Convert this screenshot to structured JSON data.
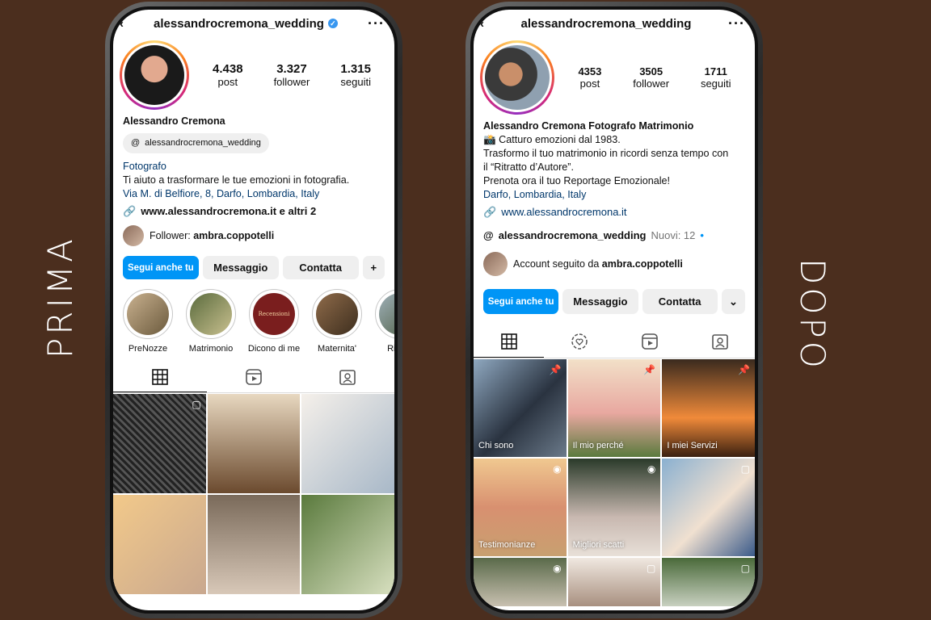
{
  "labels": {
    "before": "PRIMA",
    "after": "DOPO"
  },
  "before": {
    "username": "alessandrocremona_wedding",
    "more": "···",
    "stats": [
      {
        "num": "4.438",
        "label": "post"
      },
      {
        "num": "3.327",
        "label": "follower"
      },
      {
        "num": "1.315",
        "label": "seguiti"
      }
    ],
    "name": "Alessandro Cremona",
    "threads_handle": "alessandrocremona_wedding",
    "category": "Fotografo",
    "bio": "Ti aiuto a trasformare le tue emozioni in fotografia.",
    "address": "Via M. di Belfiore, 8, Darfo, Lombardia, Italy",
    "website": "www.alessandrocremona.it e altri 2",
    "follower_prefix": "Follower: ",
    "follower_name": "ambra.coppotelli",
    "buttons": {
      "follow": "Segui anche tu",
      "message": "Messaggio",
      "contact": "Contatta",
      "add": "+"
    },
    "highlights": [
      "PreNozze",
      "Matrimonio",
      "Dicono di me",
      "Maternita'",
      "Ritratti"
    ],
    "highlight_text": "Recensioni"
  },
  "after": {
    "username": "alessandrocremona_wedding",
    "more": "···",
    "stats": [
      {
        "num": "4353",
        "label": "post"
      },
      {
        "num": "3505",
        "label": "follower"
      },
      {
        "num": "1711",
        "label": "seguiti"
      }
    ],
    "name": "Alessandro Cremona Fotografo Matrimonio",
    "bio_lines": [
      "📸 Catturo emozioni dal 1983.",
      "Trasformo il tuo matrimonio in ricordi senza tempo con",
      "il “Ritratto d’Autore”.",
      "Prenota ora il tuo Reportage Emozionale!"
    ],
    "location": "Darfo, Lombardia, Italy",
    "website": "www.alessandrocremona.it",
    "threads_handle": "alessandrocremona_wedding",
    "threads_new": "Nuovi: 12",
    "followed_prefix": "Account seguito da ",
    "followed_name": "ambra.coppotelli",
    "buttons": {
      "follow": "Segui anche tu",
      "message": "Messaggio",
      "contact": "Contatta"
    },
    "grid_captions": [
      "Chi sono",
      "Il mio perché",
      "I miei Servizi",
      "Testimonianze",
      "Migliori scatti"
    ]
  }
}
